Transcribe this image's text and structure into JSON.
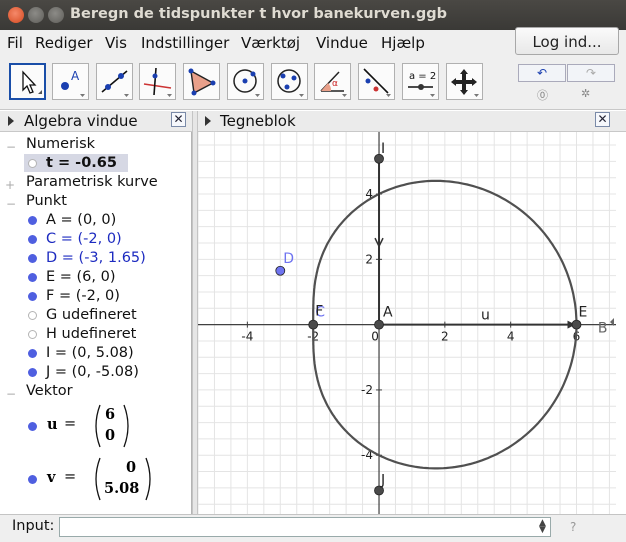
{
  "window": {
    "title": "Beregn de tidspunkter t hvor banekurven.ggb"
  },
  "menu": {
    "items": [
      "Fil",
      "Rediger",
      "Vis",
      "Indstillinger",
      "Værktøj",
      "Vindue",
      "Hjælp"
    ],
    "login_label": "Log ind..."
  },
  "toolbar": {
    "tools": [
      "move-tool",
      "point-tool",
      "line-tool",
      "perpendicular-line-tool",
      "polygon-tool",
      "circle-tool",
      "conic-tool",
      "angle-tool",
      "reflect-tool",
      "slider-tool",
      "move-view-tool"
    ],
    "slider_tool_label": "a = 2",
    "undo_label": "↶",
    "redo_label": "↷"
  },
  "algebra": {
    "title": "Algebra vindue",
    "categories": {
      "numerisk": "Numerisk",
      "parametrisk": "Parametrisk kurve",
      "punkt": "Punkt",
      "vektor": "Vektor"
    },
    "numbers": [
      {
        "text": "t = -0.65",
        "visible": false,
        "selected": true
      }
    ],
    "points": [
      {
        "text": "A = (0, 0)",
        "visible": true,
        "color": "#111111"
      },
      {
        "text": "C = (-2, 0)",
        "visible": true,
        "color": "#1d2bc0"
      },
      {
        "text": "D = (-3, 1.65)",
        "visible": true,
        "color": "#1d2bc0"
      },
      {
        "text": "E = (6, 0)",
        "visible": true,
        "color": "#111111"
      },
      {
        "text": "F = (-2, 0)",
        "visible": true,
        "color": "#111111"
      },
      {
        "text": "G udefineret",
        "visible": false,
        "color": "#111111"
      },
      {
        "text": "H udefineret",
        "visible": false,
        "color": "#111111"
      },
      {
        "text": "I = (0, 5.08)",
        "visible": true,
        "color": "#111111"
      },
      {
        "text": "J = (0, -5.08)",
        "visible": true,
        "color": "#111111"
      }
    ],
    "vectors": [
      {
        "name": "u",
        "equals": "=",
        "x": "6",
        "y": "0"
      },
      {
        "name": "v",
        "equals": "=",
        "x": "0",
        "y": "5.08"
      }
    ]
  },
  "graphics": {
    "title": "Tegneblok",
    "x_range": [
      -5.5,
      7.2
    ],
    "y_range": [
      -5.8,
      5.9
    ],
    "x_ticks": [
      "-4",
      "-2",
      "0",
      "2",
      "4",
      "6"
    ],
    "y_ticks": [
      "4",
      "2",
      "-2",
      "-4"
    ],
    "point_labels": {
      "A": "A",
      "C": "C",
      "D": "D",
      "E": "E",
      "F": "F",
      "I": "I",
      "J": "J",
      "B": "B"
    },
    "vector_label": "u",
    "colors": {
      "curve": "#505050",
      "grid": "#e4e4e4",
      "axis": "#404040",
      "point_dark": "#4a4a4a",
      "point_blue": "#6f74f0"
    }
  },
  "input": {
    "label": "Input:"
  }
}
